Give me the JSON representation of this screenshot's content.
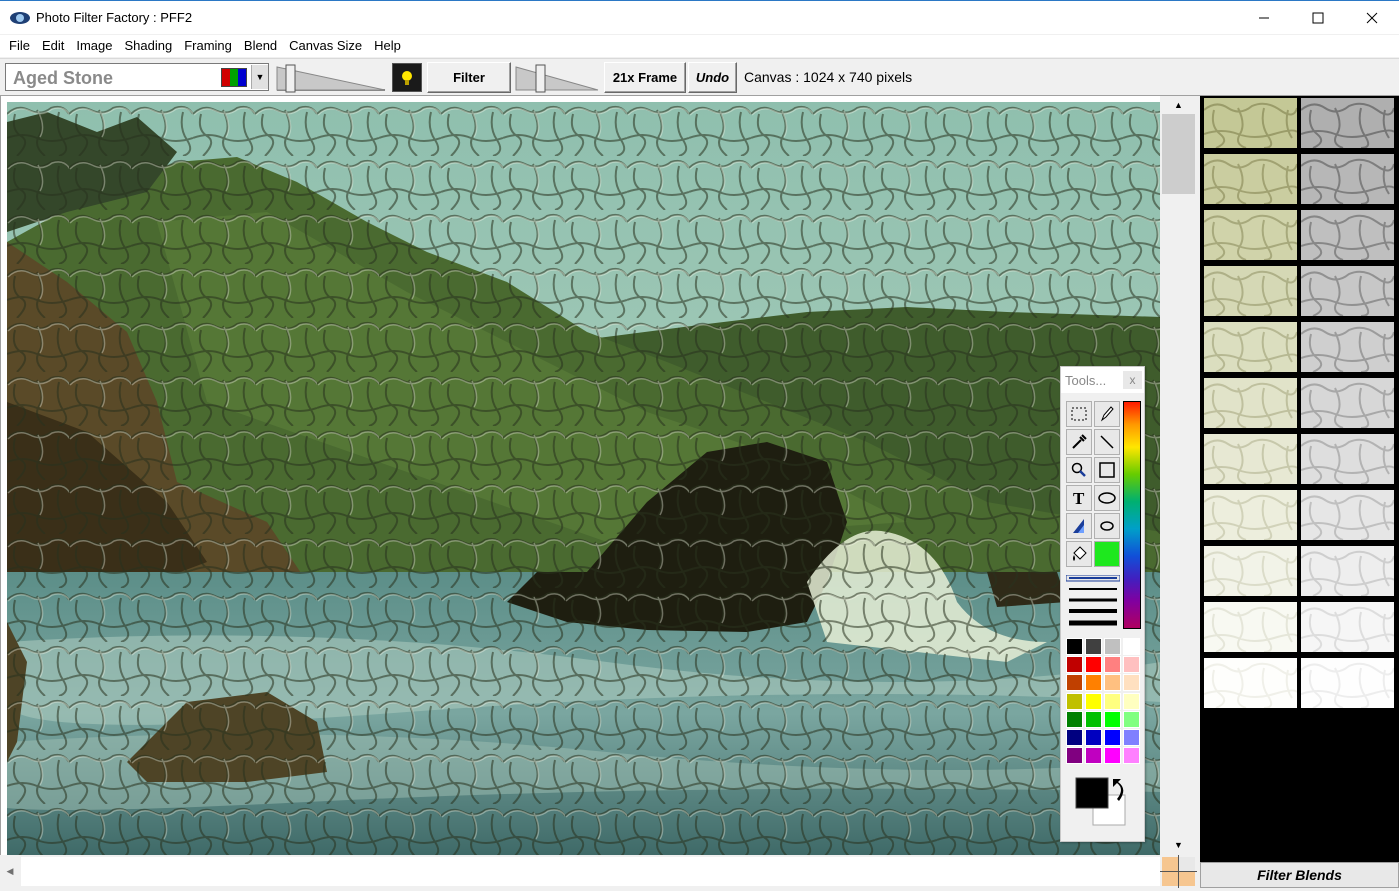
{
  "window": {
    "title": "Photo Filter Factory : PFF2"
  },
  "menu": [
    "File",
    "Edit",
    "Image",
    "Shading",
    "Framing",
    "Blend",
    "Canvas Size",
    "Help"
  ],
  "toolbar": {
    "filter_name": "Aged Stone",
    "filter_button": "Filter",
    "frame_button": "21x Frame",
    "undo_button": "Undo",
    "canvas_info": "Canvas : 1024 x 740 pixels"
  },
  "tools_palette": {
    "title": "Tools...",
    "close_label": "x",
    "tools": [
      "select-rect",
      "pencil",
      "eyedropper",
      "line",
      "magnifier",
      "rectangle",
      "text",
      "ellipse",
      "gradient-fill",
      "small-ellipse",
      "paint-bucket",
      "current-color"
    ],
    "current_tool_color": "#1ee81e",
    "palette_colors": [
      "#000000",
      "#404040",
      "#c0c0c0",
      "#ffffff",
      "#c00000",
      "#ff0000",
      "#ff8080",
      "#ffc0c0",
      "#c04000",
      "#ff8000",
      "#ffc080",
      "#ffe0c0",
      "#c0c000",
      "#ffff00",
      "#ffff80",
      "#ffffc0",
      "#008000",
      "#00c000",
      "#00ff00",
      "#80ff80",
      "#000080",
      "#0000c0",
      "#0000ff",
      "#8080ff",
      "#800080",
      "#c000c0",
      "#ff00ff",
      "#ff80ff"
    ],
    "foreground": "#000000",
    "background": "#ffffff"
  },
  "thumbnails_panel": {
    "label": "Filter Blends",
    "rows": 11
  },
  "colors": {
    "accent": "#2b78c5"
  }
}
